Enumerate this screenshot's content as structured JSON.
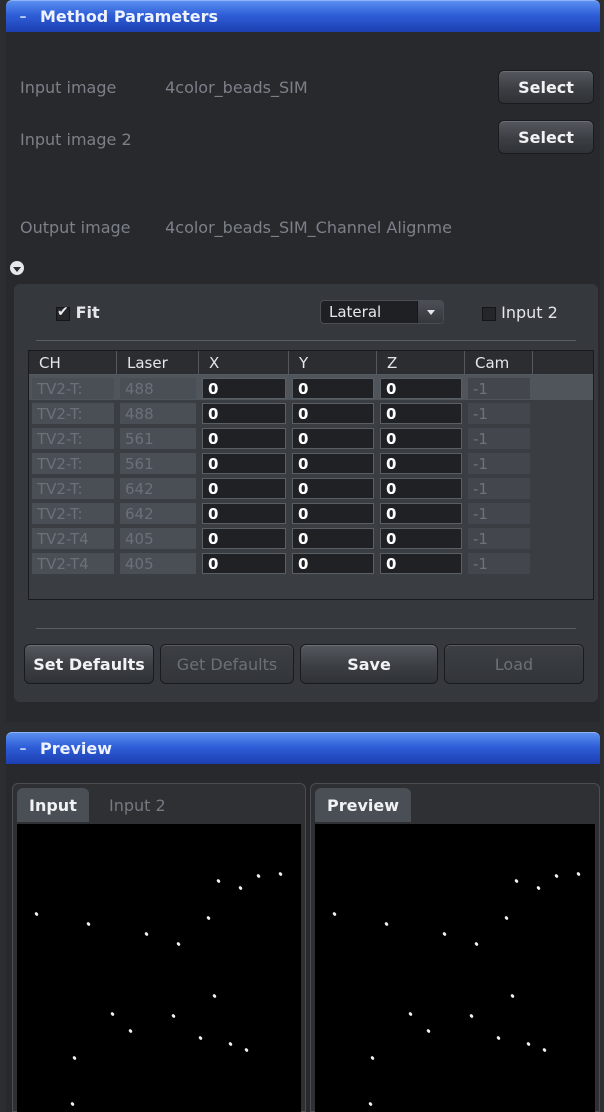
{
  "method_parameters": {
    "header": "Method Parameters",
    "input_image_label": "Input image",
    "input_image_value": "4color_beads_SIM",
    "input_image2_label": "Input image 2",
    "output_image_label": "Output image",
    "output_image_value": "4color_beads_SIM_Channel Alignme",
    "select_label": "Select",
    "fit_label": "Fit",
    "fit_checked": true,
    "mode_value": "Lateral",
    "input2_label": "Input 2",
    "input2_checked": false
  },
  "table": {
    "columns": [
      "CH",
      "Laser",
      "X",
      "Y",
      "Z",
      "Cam"
    ],
    "rows": [
      {
        "ch": "TV2-T:",
        "laser": "488",
        "x": "0",
        "y": "0",
        "z": "0",
        "cam": "-1"
      },
      {
        "ch": "TV2-T:",
        "laser": "488",
        "x": "0",
        "y": "0",
        "z": "0",
        "cam": "-1"
      },
      {
        "ch": "TV2-T:",
        "laser": "561",
        "x": "0",
        "y": "0",
        "z": "0",
        "cam": "-1"
      },
      {
        "ch": "TV2-T:",
        "laser": "561",
        "x": "0",
        "y": "0",
        "z": "0",
        "cam": "-1"
      },
      {
        "ch": "TV2-T:",
        "laser": "642",
        "x": "0",
        "y": "0",
        "z": "0",
        "cam": "-1"
      },
      {
        "ch": "TV2-T:",
        "laser": "642",
        "x": "0",
        "y": "0",
        "z": "0",
        "cam": "-1"
      },
      {
        "ch": "TV2-T4",
        "laser": "405",
        "x": "0",
        "y": "0",
        "z": "0",
        "cam": "-1"
      },
      {
        "ch": "TV2-T4",
        "laser": "405",
        "x": "0",
        "y": "0",
        "z": "0",
        "cam": "-1"
      }
    ]
  },
  "buttons": {
    "set_defaults": "Set Defaults",
    "get_defaults": "Get Defaults",
    "save": "Save",
    "load": "Load"
  },
  "preview": {
    "header": "Preview",
    "tab_input": "Input",
    "tab_input2": "Input 2",
    "tab_preview": "Preview"
  },
  "colors": {
    "header_blue": "#2f5ed8",
    "panel_bg": "#35383d",
    "window_bg": "#2b2d31"
  }
}
